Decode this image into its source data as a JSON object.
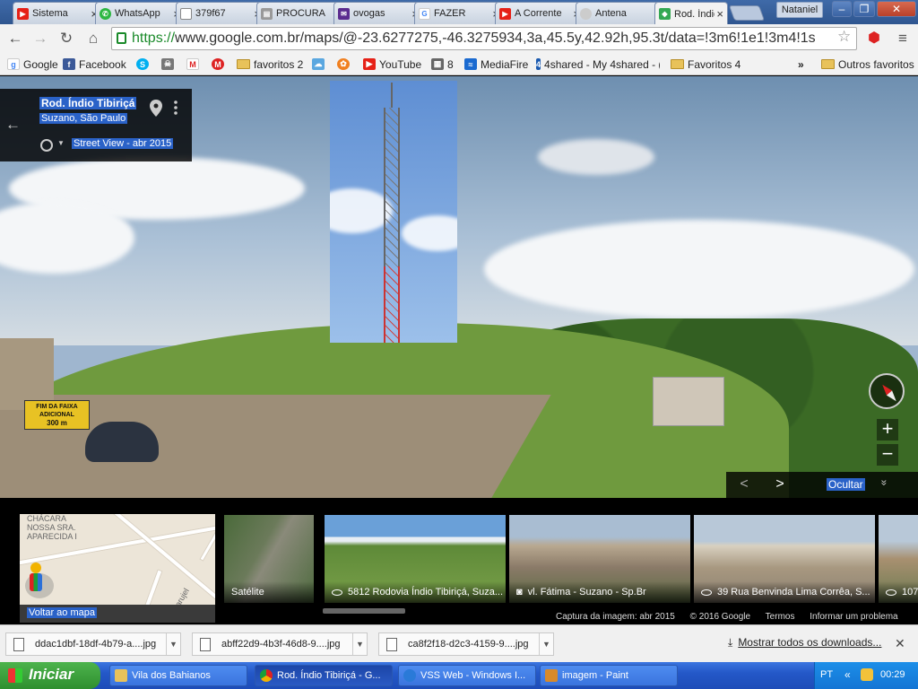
{
  "browser": {
    "tabs": [
      {
        "label": "Sistema",
        "icon": "youtube-icon",
        "color": "#e62117"
      },
      {
        "label": "WhatsApp",
        "icon": "whatsapp-icon",
        "color": "#2db742"
      },
      {
        "label": "379f67",
        "icon": "document-icon",
        "color": "#888888"
      },
      {
        "label": "PROCURA",
        "icon": "printer-icon",
        "color": "#777777"
      },
      {
        "label": "ovogas",
        "icon": "mail-icon",
        "color": "#5b2c8f"
      },
      {
        "label": "FAZER",
        "icon": "google-icon",
        "color": "#4285f4"
      },
      {
        "label": "A Corrente",
        "icon": "youtube-icon",
        "color": "#e62117"
      },
      {
        "label": "Antena",
        "icon": "web-icon",
        "color": "#888888"
      },
      {
        "label": "Rod. Índio",
        "icon": "maps-icon",
        "color": "#34a853"
      }
    ],
    "user_button": "Nataniel",
    "url_prefix": "https://",
    "url_rest": "www.google.com.br/maps/@-23.6277275,-46.3275934,3a,45.5y,42.92h,95.3t/data=!3m6!1e1!3m4!1s",
    "bookmarks": [
      {
        "label": "Google"
      },
      {
        "label": "Facebook"
      },
      {
        "label": ""
      },
      {
        "label": ""
      },
      {
        "label": ""
      },
      {
        "label": ""
      },
      {
        "label": "favoritos 2"
      },
      {
        "label": ""
      },
      {
        "label": ""
      },
      {
        "label": "YouTube"
      },
      {
        "label": "8"
      },
      {
        "label": "MediaFire"
      },
      {
        "label": "4shared - My 4shared - ("
      },
      {
        "label": "Favoritos 4"
      },
      {
        "label": "Outros favoritos"
      }
    ],
    "bookmarks_more": "»"
  },
  "maps": {
    "place_title": "Rod. Índio Tibiriçá",
    "place_subtitle": "Suzano, São Paulo",
    "street_view_date": "Street View - abr 2015",
    "back_arrow": "←",
    "zoom_in": "+",
    "zoom_out": "−",
    "nav_prev": "<",
    "nav_next": ">",
    "hide_label": "Ocultar",
    "hide_chevron": "»",
    "road_sign_line1": "FIM DA FAIXA",
    "road_sign_line2": "ADICIONAL",
    "road_sign_line3": "300 m",
    "map_tile_text1": "CHÁCARA",
    "map_tile_text2": "NOSSA SRA.",
    "map_tile_text3": "APARECIDA I",
    "map_tile_text4": "arujel",
    "back_to_map": "Voltar ao mapa",
    "thumbs": [
      {
        "label": "Satélite"
      },
      {
        "label": "5812 Rodovia Índio Tibiriçá, Suza..."
      },
      {
        "label": "vl. Fátima - Suzano - Sp.Br"
      },
      {
        "label": "39 Rua Benvinda Lima Corrêa, S..."
      },
      {
        "label": "107"
      }
    ],
    "footer": {
      "capture": "Captura da imagem: abr 2015",
      "copyright": "© 2016 Google",
      "terms": "Termos",
      "report": "Informar um problema"
    }
  },
  "downloads": {
    "items": [
      {
        "name": "ddac1dbf-18df-4b79-a....jpg"
      },
      {
        "name": "abff22d9-4b3f-46d8-9....jpg"
      },
      {
        "name": "ca8f2f18-d2c3-4159-9....jpg"
      }
    ],
    "show_all": "Mostrar todos os downloads...",
    "close": "✕"
  },
  "taskbar": {
    "start": "Iniciar",
    "tasks": [
      {
        "label": "Vila dos Bahianos",
        "color": "#e8c25a"
      },
      {
        "label": "Rod. Índio Tibiriçá - G...",
        "color": "#4285f4"
      },
      {
        "label": "VSS Web - Windows I...",
        "color": "#2a7ad8"
      },
      {
        "label": "imagem - Paint",
        "color": "#d88a2a"
      }
    ],
    "language": "PT",
    "time": "00:29"
  }
}
